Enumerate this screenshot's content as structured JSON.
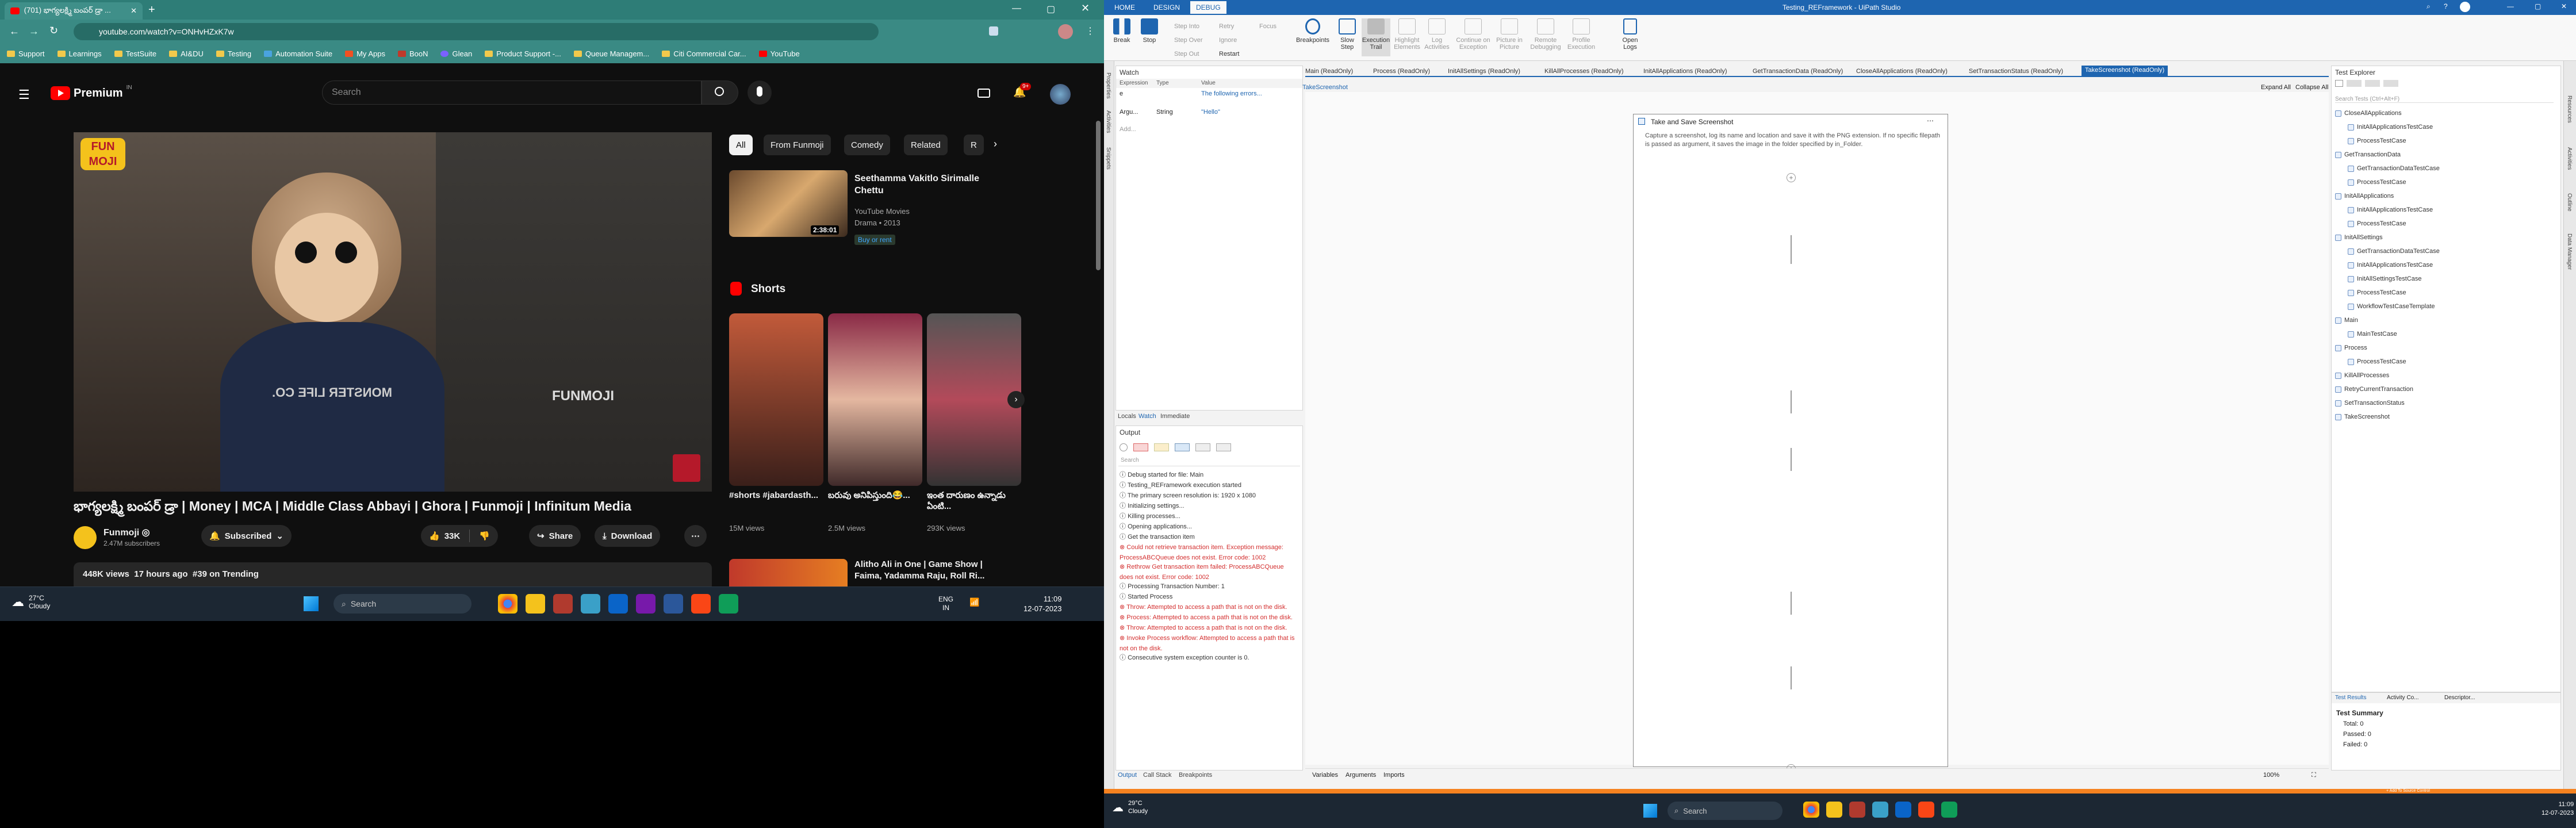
{
  "chrome": {
    "tab_title": "(701) భాగ్యలక్ష్మి బంపర్ డ్రా ...",
    "url": "youtube.com/watch?v=ONHvHZxK7w",
    "bookmarks": [
      "Support",
      "Learnings",
      "TestSuite",
      "AI&DU",
      "Testing",
      "Automation Suite",
      "My Apps",
      "BooN",
      "Glean",
      "Product Support -...",
      "Queue Managem...",
      "Citi Commercial Car...",
      "YouTube"
    ]
  },
  "youtube": {
    "logo": "Premium",
    "logo_region": "IN",
    "search_placeholder": "Search",
    "notif_badge": "9+",
    "chips": [
      "All",
      "From Funmoji",
      "Comedy",
      "Related",
      "R"
    ],
    "video_title": "భాగ్యలక్ష్మి బంపర్ డ్రా | Money | MCA | Middle Class Abbayi | Ghora | Funmoji | Infinitum Media",
    "channel": "Funmoji ◎",
    "subscribers": "2.47M subscribers",
    "subscribed_label": "Subscribed",
    "likes": "33K",
    "share_label": "Share",
    "download_label": "Download",
    "views_line": "448K views  17 hours ago  #39 on Trending",
    "watermark": "FUNMOJI",
    "shirt_text": "MONSTER LIFE CO.",
    "logo_text": "FUN MOJI",
    "rec1": {
      "title": "Seethamma Vakitlo Sirimalle Chettu",
      "sub1": "YouTube Movies",
      "sub2": "Drama • 2013",
      "badge": "Buy or rent",
      "duration": "2:38:01"
    },
    "shorts_label": "Shorts",
    "shorts": [
      {
        "title": "#shorts #jabardasth...",
        "views": "15M views"
      },
      {
        "title": "బరువు అనిపిస్తుంది😂...",
        "views": "2.5M views"
      },
      {
        "title": "ఇంత దారుణం ఉన్నాడు ఏంటి...",
        "views": "293K views"
      }
    ],
    "rec2": {
      "title": "Alitho Ali in One | Game Show | Faima, Yadamma Raju, Roll Ri..."
    }
  },
  "taskbar_left": {
    "weather_temp": "27°C",
    "weather_desc": "Cloudy",
    "search": "Search",
    "lang1": "ENG",
    "lang2": "IN",
    "time": "11:09",
    "date": "12-07-2023"
  },
  "uipath": {
    "window_title": "Testing_REFramework - UiPath Studio",
    "menu": [
      "HOME",
      "DESIGN",
      "DEBUG"
    ],
    "ribbon": [
      {
        "label": "Break",
        "sub": ""
      },
      {
        "label": "Stop",
        "sub": ""
      },
      {
        "label": "Breakpoints",
        "sub": ""
      },
      {
        "label": "Slow",
        "sub": "Step"
      },
      {
        "label": "Execution",
        "sub": "Trail"
      },
      {
        "label": "Highlight",
        "sub": "Elements"
      },
      {
        "label": "Log",
        "sub": "Activities"
      },
      {
        "label": "Continue on",
        "sub": "Exception"
      },
      {
        "label": "Picture in",
        "sub": "Picture"
      },
      {
        "label": "Remote",
        "sub": "Debugging"
      },
      {
        "label": "Profile",
        "sub": "Execution"
      },
      {
        "label": "Open",
        "sub": "Logs"
      }
    ],
    "ribbon_small": [
      "Step Into",
      "Step Over",
      "Step Out",
      "Retry",
      "Ignore",
      "Restart",
      "Focus"
    ],
    "watch": {
      "title": "Watch",
      "cols": [
        "Expression",
        "Type",
        "Value"
      ],
      "rows": [
        [
          "e",
          "",
          "The following errors..."
        ],
        [
          "Argu...",
          "String",
          "\"Hello\""
        ]
      ],
      "add": "Add..."
    },
    "locals_tabs": [
      "Locals",
      "Watch",
      "Immediate"
    ],
    "output_title": "Output",
    "output_search": "Search",
    "output_lines": [
      {
        "t": "Debug started for file: Main",
        "err": false
      },
      {
        "t": "Testing_REFramework execution started",
        "err": false
      },
      {
        "t": "The primary screen resolution is: 1920 x 1080",
        "err": false
      },
      {
        "t": "Initializing settings...",
        "err": false
      },
      {
        "t": "Killing processes...",
        "err": false
      },
      {
        "t": "Opening applications...",
        "err": false
      },
      {
        "t": "Get the transaction item",
        "err": false
      },
      {
        "t": "Could not retrieve transaction item. Exception message: ProcessABCQueue does not exist. Error code: 1002",
        "err": true
      },
      {
        "t": "Rethrow Get transaction item failed: ProcessABCQueue does not exist. Error code: 1002",
        "err": true
      },
      {
        "t": "Processing Transaction Number: 1",
        "err": false
      },
      {
        "t": "Started Process",
        "err": false
      },
      {
        "t": "Throw: Attempted to access a path that is not on the disk.",
        "err": true
      },
      {
        "t": "Process: Attempted to access a path that is not on the disk.",
        "err": true
      },
      {
        "t": "Throw: Attempted to access a path that is not on the disk.",
        "err": true
      },
      {
        "t": "Invoke Process workflow: Attempted to access a path that is not on the disk.",
        "err": true
      },
      {
        "t": "Consecutive system exception counter is 0.",
        "err": false
      }
    ],
    "bottom_tabs": [
      "Output",
      "Call Stack",
      "Breakpoints"
    ],
    "doc_tabs": [
      "Main (ReadOnly)",
      "Process (ReadOnly)",
      "InitAllSettings (ReadOnly)",
      "KillAllProcesses (ReadOnly)",
      "InitAllApplications (ReadOnly)",
      "GetTransactionData (ReadOnly)",
      "CloseAllApplications (ReadOnly)",
      "SetTransactionStatus (ReadOnly)",
      "TakeScreenshot (ReadOnly)"
    ],
    "breadcrumb": "TakeScreenshot",
    "expand_all": "Expand All",
    "collapse_all": "Collapse All",
    "activity": {
      "title": "Take and Save Screenshot",
      "desc": "Capture a screenshot, log its name and location and save it with the PNG extension. If no specific filepath is passed as argument, it saves the image in the folder specified by in_Folder."
    },
    "designer_bottom": [
      "Variables",
      "Arguments",
      "Imports"
    ],
    "zoom": "100%",
    "test_explorer": {
      "title": "Test Explorer",
      "search": "Search Tests (Ctrl+Alt+F)",
      "items": [
        {
          "t": "CloseAllApplications",
          "lvl": 0
        },
        {
          "t": "InitAllApplicationsTestCase",
          "lvl": 1
        },
        {
          "t": "ProcessTestCase",
          "lvl": 1
        },
        {
          "t": "GetTransactionData",
          "lvl": 0
        },
        {
          "t": "GetTransactionDataTestCase",
          "lvl": 1
        },
        {
          "t": "ProcessTestCase",
          "lvl": 1
        },
        {
          "t": "InitAllApplications",
          "lvl": 0
        },
        {
          "t": "InitAllApplicationsTestCase",
          "lvl": 1
        },
        {
          "t": "ProcessTestCase",
          "lvl": 1
        },
        {
          "t": "InitAllSettings",
          "lvl": 0
        },
        {
          "t": "GetTransactionDataTestCase",
          "lvl": 1
        },
        {
          "t": "InitAllApplicationsTestCase",
          "lvl": 1
        },
        {
          "t": "InitAllSettingsTestCase",
          "lvl": 1
        },
        {
          "t": "ProcessTestCase",
          "lvl": 1
        },
        {
          "t": "WorkflowTestCaseTemplate",
          "lvl": 1
        },
        {
          "t": "Main",
          "lvl": 0
        },
        {
          "t": "MainTestCase",
          "lvl": 1
        },
        {
          "t": "Process",
          "lvl": 0
        },
        {
          "t": "ProcessTestCase",
          "lvl": 1
        },
        {
          "t": "KillAllProcesses",
          "lvl": 0
        },
        {
          "t": "RetryCurrentTransaction",
          "lvl": 0
        },
        {
          "t": "SetTransactionStatus",
          "lvl": 0
        },
        {
          "t": "TakeScreenshot",
          "lvl": 0
        }
      ],
      "tabs": [
        "Test Results",
        "Activity Co...",
        "Descriptor..."
      ],
      "summary_title": "Test Summary",
      "total": "Total: 0",
      "passed": "Passed: 0",
      "failed": "Failed: 0"
    },
    "side_tabs": [
      "Properties",
      "Activities",
      "Snippets"
    ],
    "right_side_tabs": [
      "Resources",
      "Activities",
      "Outline",
      "Data Manager"
    ],
    "status": {
      "left": "",
      "source_control": "+ Add To Source Control",
      "studio": "UiPath"
    },
    "taskbar": {
      "weather_temp": "29°C",
      "weather_desc": "Cloudy",
      "search": "Search",
      "time": "11:09",
      "date": "12-07-2023"
    }
  }
}
